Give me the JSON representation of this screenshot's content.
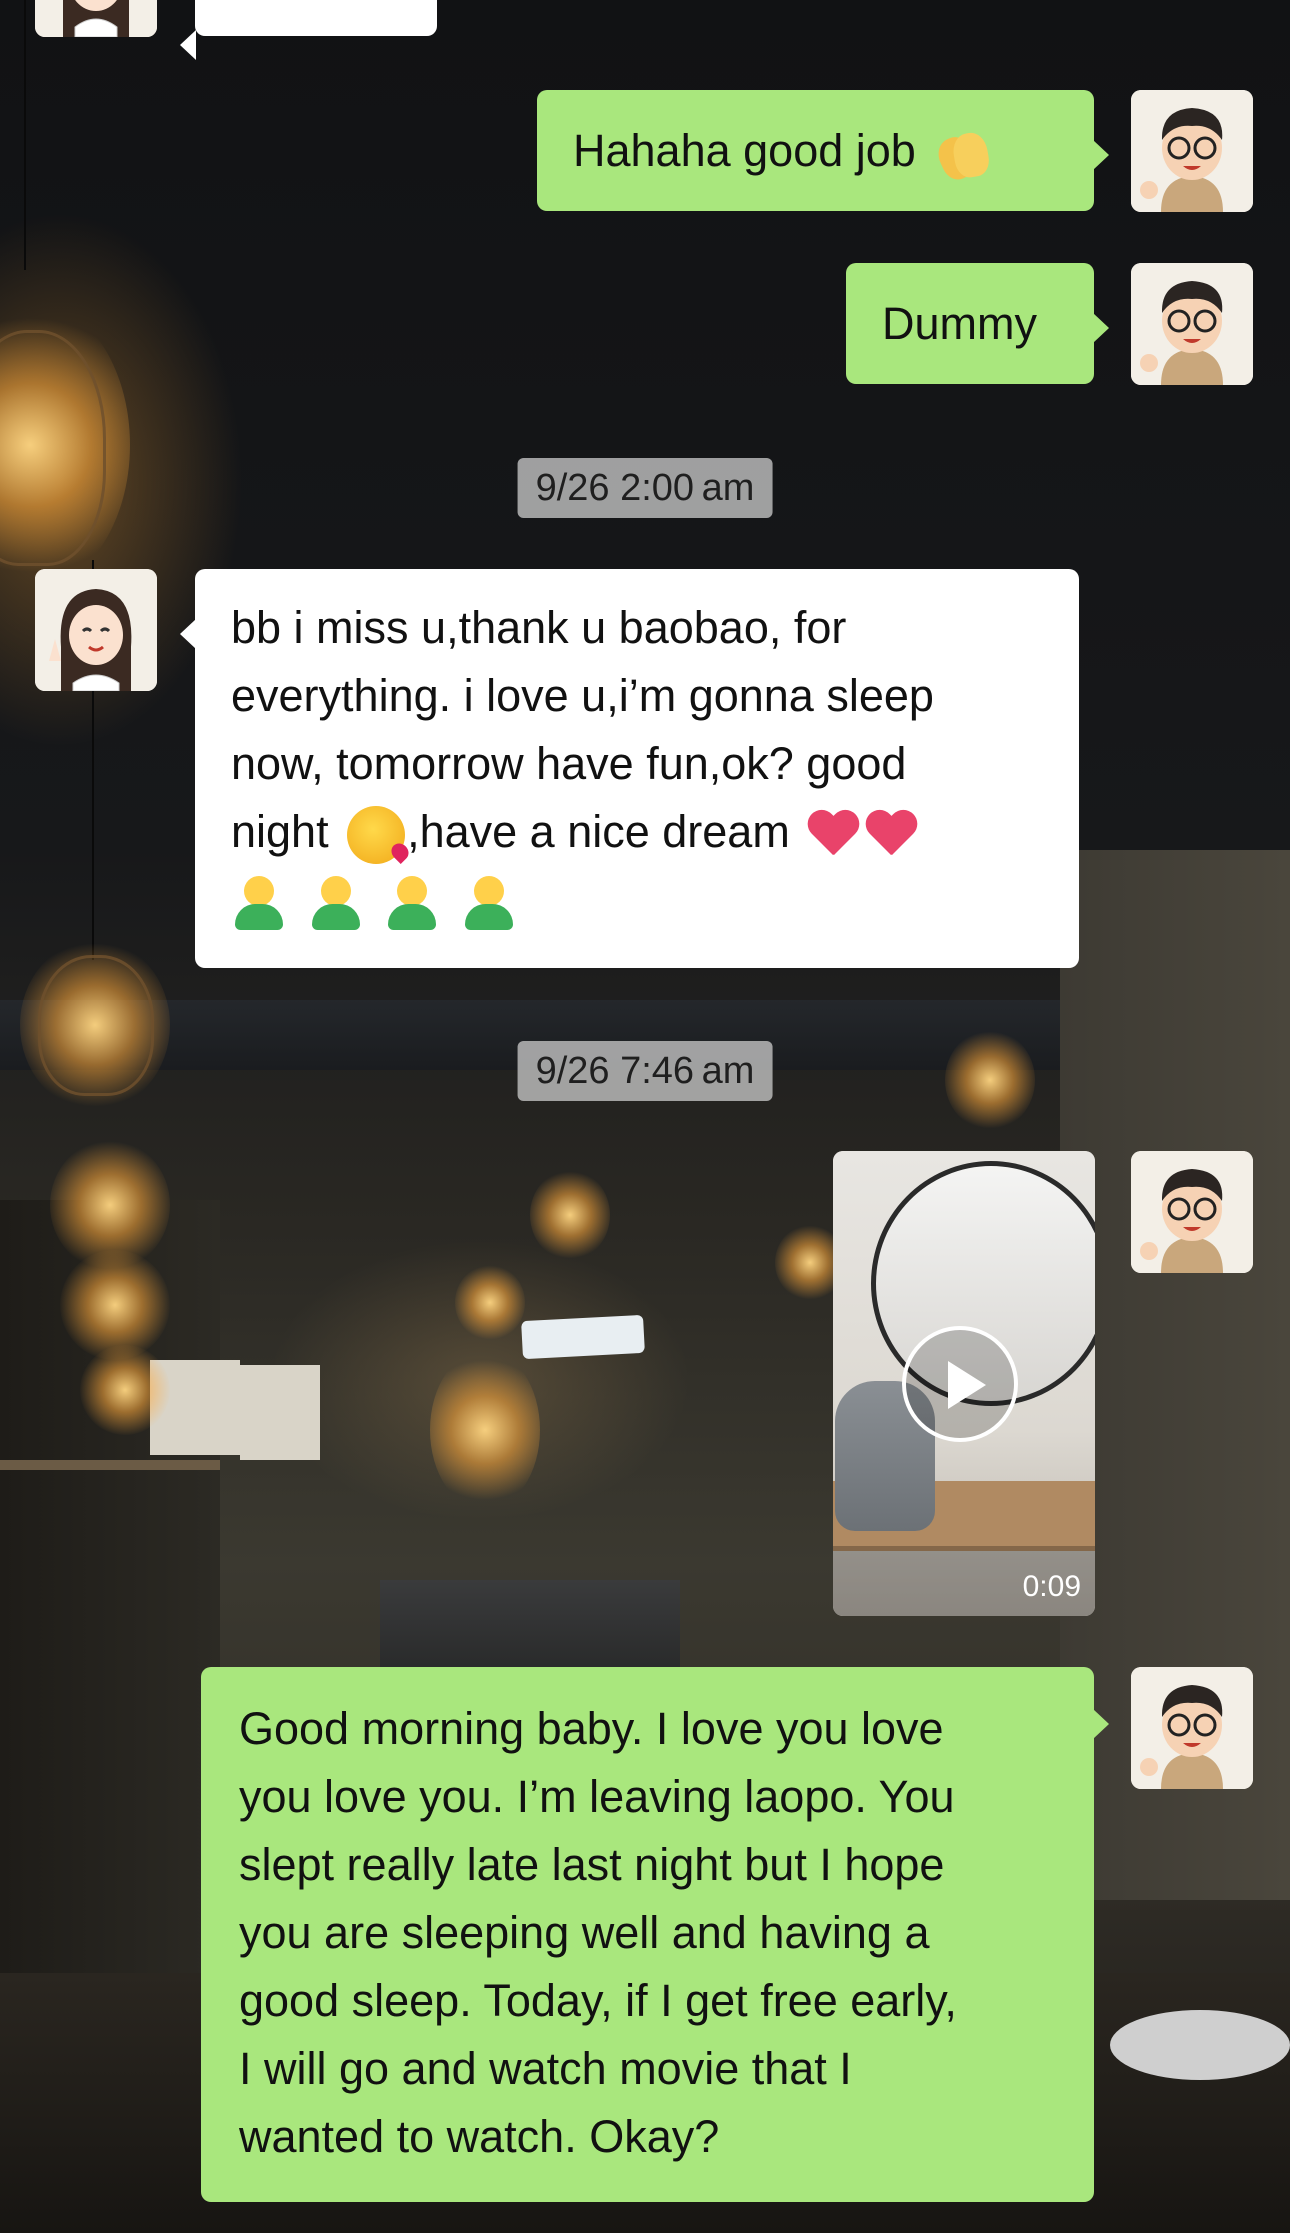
{
  "messages": [
    {
      "sender": "me",
      "text": "Hahaha good job",
      "emoji": "clapping-hands"
    },
    {
      "sender": "me",
      "text": "Dummy"
    },
    {
      "sender": "her",
      "line1": "bb i miss u,thank u baobao, for",
      "line2": "everything. i love u,i’m gonna sleep",
      "line3": "now, tomorrow have fun,ok? good",
      "line4a": "night ",
      "line4b": ",have a nice dream ",
      "emojis": [
        "kissing-face",
        "red-heart",
        "red-heart",
        "person-green-shirt",
        "person-green-shirt",
        "person-green-shirt",
        "person-green-shirt"
      ]
    },
    {
      "sender": "me",
      "type": "video",
      "duration": "0:09"
    },
    {
      "sender": "me",
      "lines": [
        "Good morning baby. I love you love",
        "you love you. I’m leaving laopo. You",
        "slept really late last night but I hope",
        "you are sleeping well and having a",
        "good sleep. Today, if I get free early,",
        "I will go and watch movie that I",
        "wanted to watch. Okay?"
      ]
    }
  ],
  "timestamps": [
    "9/26 2:00 am",
    "9/26 7:46 am"
  ],
  "colors": {
    "my_bubble": "#a9e77d",
    "her_bubble": "#ffffff",
    "timestamp_bg": "#bebebe"
  },
  "icons": {
    "play": "play-icon"
  }
}
